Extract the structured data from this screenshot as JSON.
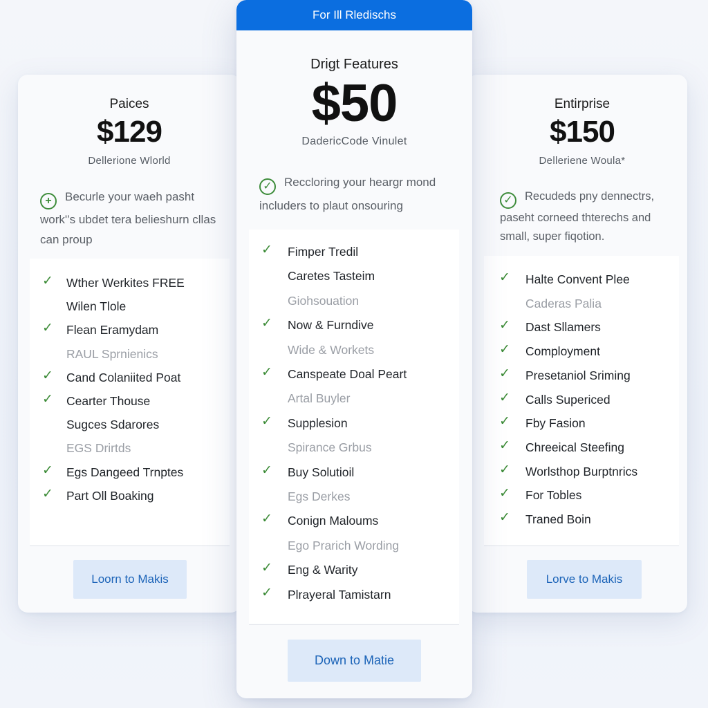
{
  "plans": {
    "left": {
      "name": "Paices",
      "price": "$129",
      "tagline": "Dellerione Wlorld",
      "summary_icon": "plus-circle-icon",
      "summary_line1": "Becurle your waeh pasht",
      "summary_line2": "work'’s ubdet tera belieshurn cllas",
      "summary_line3": "can proup",
      "features": [
        {
          "text": "Wther Werkites FREE",
          "checked": true,
          "muted": false
        },
        {
          "text": "Wilen Tlole",
          "checked": false,
          "muted": false
        },
        {
          "text": "Flean Eramydam",
          "checked": true,
          "muted": false
        },
        {
          "text": "RAUL Sprnienics",
          "checked": false,
          "muted": true
        },
        {
          "text": "Cand Colaniited Poat",
          "checked": true,
          "muted": false
        },
        {
          "text": "Cearter Thouse",
          "checked": true,
          "muted": false
        },
        {
          "text": "Sugces Sdarores",
          "checked": false,
          "muted": false
        },
        {
          "text": "EGS Drirtds",
          "checked": false,
          "muted": true
        },
        {
          "text": "Egs Dangeed Trnptes",
          "checked": true,
          "muted": false
        },
        {
          "text": "Part Oll Boaking",
          "checked": true,
          "muted": false
        }
      ],
      "cta_label": "Loorn to Makis"
    },
    "center": {
      "banner": "For Ill Rledischs",
      "name": "Drigt Features",
      "price": "$50",
      "tagline": "DadericCode Vinulet",
      "summary_icon": "check-circle-icon",
      "summary_line1": "Reccloring your heargr mond",
      "summary_line2": "includers to plaut onsouring",
      "features": [
        {
          "text": "Fimper Tredil",
          "checked": true,
          "muted": false
        },
        {
          "text": "Caretes Tasteim",
          "checked": false,
          "muted": false
        },
        {
          "text": "Giohsouation",
          "checked": false,
          "muted": true
        },
        {
          "text": "Now & Furndive",
          "checked": true,
          "muted": false
        },
        {
          "text": "Wide & Workets",
          "checked": false,
          "muted": true
        },
        {
          "text": "Canspeate Doal Peart",
          "checked": true,
          "muted": false
        },
        {
          "text": "Artal Buyler",
          "checked": false,
          "muted": true
        },
        {
          "text": "Supplesion",
          "checked": true,
          "muted": false
        },
        {
          "text": "Spirance Grbus",
          "checked": false,
          "muted": true
        },
        {
          "text": "Buy Solutioil",
          "checked": true,
          "muted": false
        },
        {
          "text": "Egs Derkes",
          "checked": false,
          "muted": true
        },
        {
          "text": "Conign Maloums",
          "checked": true,
          "muted": false
        },
        {
          "text": "Ego Prarich Wording",
          "checked": false,
          "muted": true
        },
        {
          "text": "Eng & Warity",
          "checked": true,
          "muted": false
        },
        {
          "text": "Plrayeral Tamistarn",
          "checked": true,
          "muted": false
        }
      ],
      "cta_label": "Down to Matie"
    },
    "right": {
      "name": "Entirprise",
      "price": "$150",
      "tagline": "Delleriene Woula*",
      "summary_icon": "check-circle-icon",
      "summary_line1": "Recudeds pny dennectrs,",
      "summary_line2": "paseht corneed thterechs and",
      "summary_line3": "small, super fiqotion.",
      "features": [
        {
          "text": "Halte Convent Plee",
          "checked": true,
          "muted": false
        },
        {
          "text": "Caderas Palia",
          "checked": false,
          "muted": true
        },
        {
          "text": "Dast Sllamers",
          "checked": true,
          "muted": false
        },
        {
          "text": "Comployment",
          "checked": true,
          "muted": false
        },
        {
          "text": "Presetaniol Sriming",
          "checked": true,
          "muted": false
        },
        {
          "text": "Calls Supericed",
          "checked": true,
          "muted": false
        },
        {
          "text": "Fby Fasion",
          "checked": true,
          "muted": false
        },
        {
          "text": "Chreeical Steefing",
          "checked": true,
          "muted": false
        },
        {
          "text": "Worlsthop Burptnrics",
          "checked": true,
          "muted": false
        },
        {
          "text": "For Tobles",
          "checked": true,
          "muted": false
        },
        {
          "text": "Traned Boin",
          "checked": true,
          "muted": false
        }
      ],
      "cta_label": "Lorve to Makis"
    }
  },
  "colors": {
    "accent": "#0b6ee0",
    "check": "#3a8a35",
    "cta_bg": "#dde9f9",
    "cta_text": "#1c64b8"
  }
}
